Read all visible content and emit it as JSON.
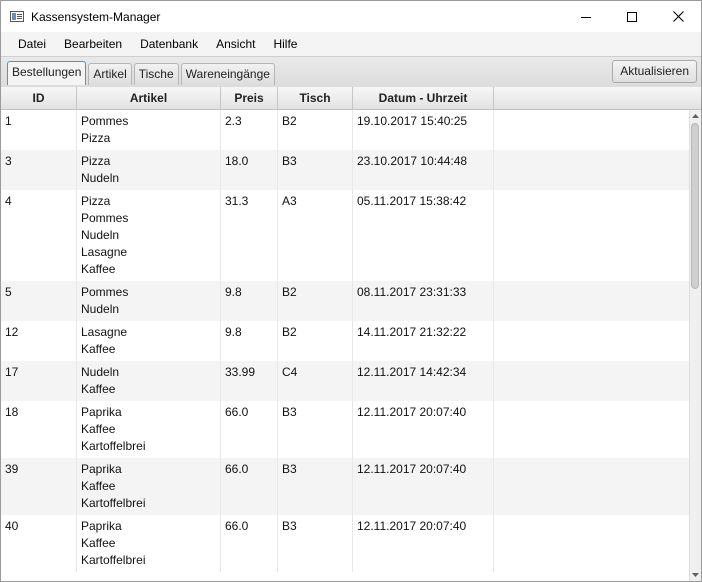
{
  "window": {
    "title": "Kassensystem-Manager",
    "controls": {
      "minimize": "minimize-icon",
      "maximize": "maximize-icon",
      "close": "close-icon"
    }
  },
  "menu": [
    "Datei",
    "Bearbeiten",
    "Datenbank",
    "Ansicht",
    "Hilfe"
  ],
  "tabs": [
    {
      "label": "Bestellungen",
      "active": true
    },
    {
      "label": "Artikel",
      "active": false
    },
    {
      "label": "Tische",
      "active": false
    },
    {
      "label": "Wareneingänge",
      "active": false
    }
  ],
  "toolbar": {
    "refresh_label": "Aktualisieren"
  },
  "table": {
    "columns": [
      "ID",
      "Artikel",
      "Preis",
      "Tisch",
      "Datum - Uhrzeit"
    ],
    "rows": [
      {
        "id": "1",
        "items": [
          "Pommes",
          "Pizza"
        ],
        "preis": "2.3",
        "tisch": "B2",
        "datum": "19.10.2017 15:40:25"
      },
      {
        "id": "3",
        "items": [
          "Pizza",
          "Nudeln"
        ],
        "preis": "18.0",
        "tisch": "B3",
        "datum": "23.10.2017 10:44:48"
      },
      {
        "id": "4",
        "items": [
          "Pizza",
          "Pommes",
          "Nudeln",
          "Lasagne",
          "Kaffee"
        ],
        "preis": "31.3",
        "tisch": "A3",
        "datum": "05.11.2017 15:38:42"
      },
      {
        "id": "5",
        "items": [
          "Pommes",
          "Nudeln"
        ],
        "preis": "9.8",
        "tisch": "B2",
        "datum": "08.11.2017 23:31:33"
      },
      {
        "id": "12",
        "items": [
          "Lasagne",
          "Kaffee"
        ],
        "preis": "9.8",
        "tisch": "B2",
        "datum": "14.11.2017 21:32:22"
      },
      {
        "id": "17",
        "items": [
          "Nudeln",
          "Kaffee"
        ],
        "preis": "33.99",
        "tisch": "C4",
        "datum": "12.11.2017 14:42:34"
      },
      {
        "id": "18",
        "items": [
          "Paprika",
          "Kaffee",
          "Kartoffelbrei"
        ],
        "preis": "66.0",
        "tisch": "B3",
        "datum": "12.11.2017 20:07:40"
      },
      {
        "id": "39",
        "items": [
          "Paprika",
          "Kaffee",
          "Kartoffelbrei"
        ],
        "preis": "66.0",
        "tisch": "B3",
        "datum": "12.11.2017 20:07:40"
      },
      {
        "id": "40",
        "items": [
          "Paprika",
          "Kaffee",
          "Kartoffelbrei"
        ],
        "preis": "66.0",
        "tisch": "B3",
        "datum": "12.11.2017 20:07:40"
      }
    ]
  },
  "scrollbar": {
    "position": 0
  }
}
